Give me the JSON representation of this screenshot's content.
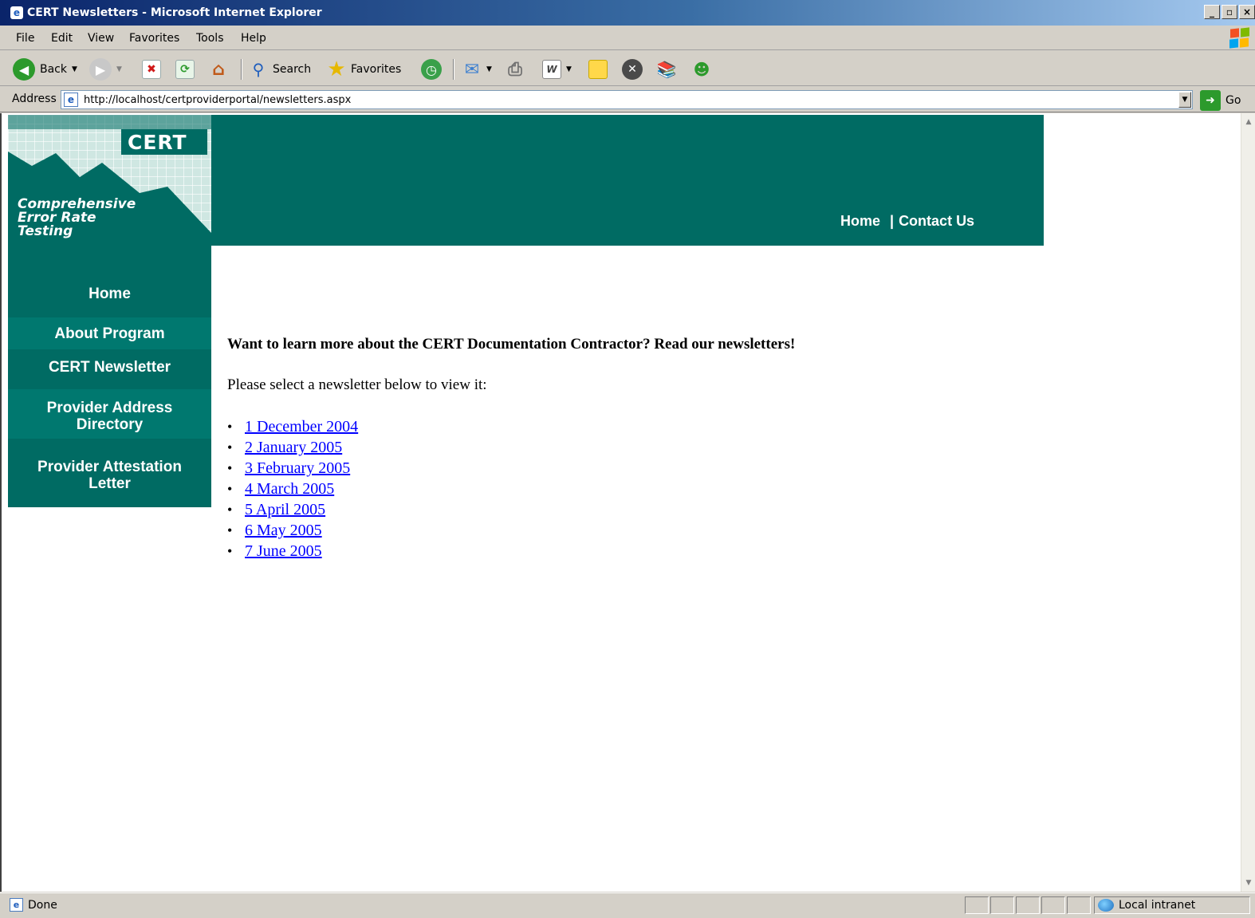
{
  "window": {
    "title": "CERT Newsletters - Microsoft Internet Explorer",
    "buttons": [
      "_",
      "▫",
      "×"
    ]
  },
  "menu": [
    "File",
    "Edit",
    "View",
    "Favorites",
    "Tools",
    "Help"
  ],
  "toolbar": {
    "back_label": "Back",
    "search_label": "Search",
    "favorites_label": "Favorites"
  },
  "address": {
    "label": "Address",
    "url": "http://localhost/certproviderportal/newsletters.aspx",
    "go_label": "Go"
  },
  "site": {
    "logo_word": "CERT",
    "tagline": [
      "Comprehensive",
      "Error Rate",
      "Testing"
    ],
    "topnav": [
      "Home",
      "Contact Us"
    ],
    "sidebar": [
      [
        "Home"
      ],
      [
        "About Program"
      ],
      [
        "CERT Newsletter"
      ],
      [
        "Provider Address",
        "Directory"
      ],
      [
        "Provider Attestation",
        "Letter"
      ]
    ],
    "brand_color": "#006b63"
  },
  "content": {
    "heading": "Want to learn more about the CERT Documentation Contractor? Read our newsletters!",
    "intro": "Please select a newsletter below to view it:",
    "newsletters": [
      "1 December 2004",
      "2 January 2005",
      "3 February 2005",
      "4 March 2005",
      "5 April 2005",
      "6 May 2005",
      "7 June 2005"
    ]
  },
  "status": {
    "text": "Done",
    "zone": "Local intranet"
  }
}
